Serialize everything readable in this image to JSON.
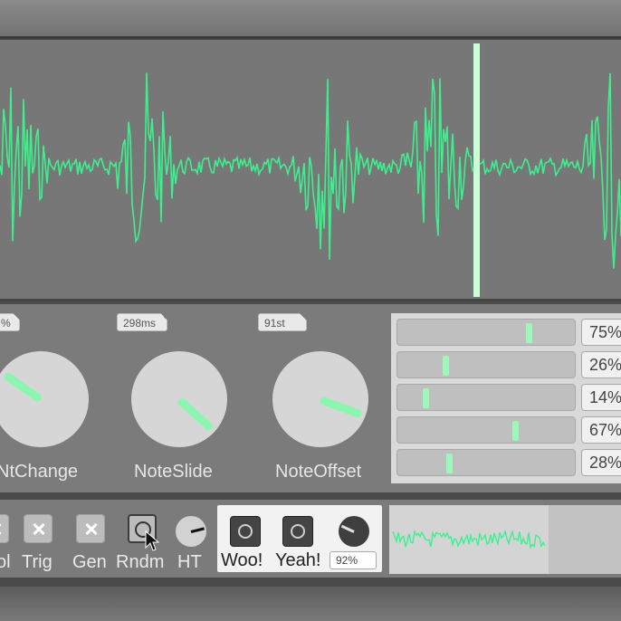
{
  "colors": {
    "accent": "#8cf5b0",
    "wave": "#3df08e",
    "playhead": "#c8ffd6",
    "panel": "#7b7b7b"
  },
  "knobs": [
    {
      "label": "NtChange",
      "tag": "%",
      "level": 0.3
    },
    {
      "label": "NoteSlide",
      "tag": "298ms",
      "level": 0.58
    },
    {
      "label": "NoteOffset",
      "tag": "91st",
      "level": 0.72
    }
  ],
  "sliders": [
    {
      "value": 75,
      "display": "75%"
    },
    {
      "value": 26,
      "display": "26%"
    },
    {
      "value": 14,
      "display": "14%"
    },
    {
      "value": 67,
      "display": "67%"
    },
    {
      "value": 28,
      "display": "28%"
    }
  ],
  "strip": {
    "items": [
      {
        "label": "ol",
        "kind": "toggle-partial"
      },
      {
        "label": "Trig",
        "kind": "toggle-x"
      },
      {
        "label": "Gen",
        "kind": "toggle-x"
      },
      {
        "label": "Rndm",
        "kind": "toggle-o"
      },
      {
        "label": "HT",
        "kind": "small-knob"
      }
    ],
    "box": {
      "woo_label": "Woo!",
      "yeah_label": "Yeah!",
      "percent": "92%"
    }
  },
  "icons": {
    "cursor": "pointer-arrow-icon",
    "toggle_on": "x-icon",
    "toggle_off": "circle-icon"
  }
}
